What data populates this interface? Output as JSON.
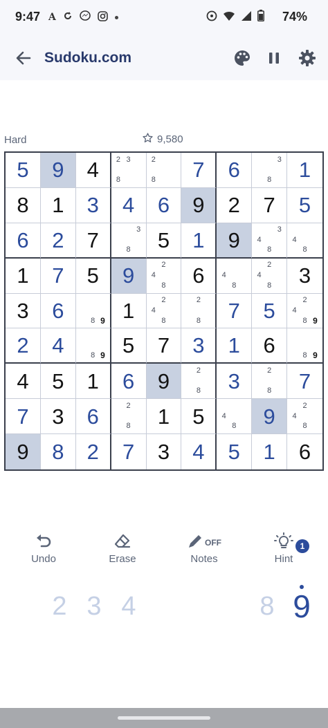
{
  "status_bar": {
    "time": "9:47",
    "battery": "74%"
  },
  "app_bar": {
    "title": "Sudoku.com"
  },
  "game": {
    "difficulty": "Hard",
    "score": "9,580"
  },
  "board": {
    "rows": [
      [
        {
          "v": "5",
          "t": "user"
        },
        {
          "v": "9",
          "t": "user",
          "hl": true
        },
        {
          "v": "4",
          "t": "given"
        },
        {
          "n": [
            "2",
            "3",
            "",
            "",
            "",
            "",
            "8",
            "",
            ""
          ]
        },
        {
          "n": [
            "2",
            "",
            "",
            "",
            "",
            "",
            "8",
            "",
            ""
          ],
          "c": true
        },
        {
          "v": "7",
          "t": "user"
        },
        {
          "v": "6",
          "t": "user"
        },
        {
          "n": [
            "",
            "",
            "3",
            "",
            "",
            "",
            "",
            "8",
            ""
          ]
        },
        {
          "v": "1",
          "t": "user"
        }
      ],
      [
        {
          "v": "8",
          "t": "given"
        },
        {
          "v": "1",
          "t": "given"
        },
        {
          "v": "3",
          "t": "user"
        },
        {
          "v": "4",
          "t": "user"
        },
        {
          "v": "6",
          "t": "user"
        },
        {
          "v": "9",
          "t": "given",
          "hl": true
        },
        {
          "v": "2",
          "t": "given"
        },
        {
          "v": "7",
          "t": "given"
        },
        {
          "v": "5",
          "t": "user"
        }
      ],
      [
        {
          "v": "6",
          "t": "user"
        },
        {
          "v": "2",
          "t": "user"
        },
        {
          "v": "7",
          "t": "given"
        },
        {
          "n": [
            "",
            "",
            "3",
            "",
            "",
            "",
            "",
            "8",
            ""
          ]
        },
        {
          "v": "5",
          "t": "given"
        },
        {
          "v": "1",
          "t": "user"
        },
        {
          "v": "9",
          "t": "given",
          "hl": true
        },
        {
          "n": [
            "",
            "",
            "3",
            "4",
            "",
            "",
            "",
            "8",
            ""
          ]
        },
        {
          "n": [
            "",
            "",
            "",
            "4",
            "",
            "",
            "",
            "8",
            ""
          ]
        }
      ],
      [
        {
          "v": "1",
          "t": "given"
        },
        {
          "v": "7",
          "t": "user"
        },
        {
          "v": "5",
          "t": "given"
        },
        {
          "v": "9",
          "t": "user",
          "hl": true
        },
        {
          "n": [
            "",
            "2",
            "",
            "4",
            "",
            "",
            "",
            "8",
            ""
          ]
        },
        {
          "v": "6",
          "t": "given"
        },
        {
          "n": [
            "",
            "",
            "",
            "4",
            "",
            "",
            "",
            "8",
            ""
          ]
        },
        {
          "n": [
            "",
            "2",
            "",
            "4",
            "",
            "",
            "",
            "8",
            ""
          ]
        },
        {
          "v": "3",
          "t": "given"
        }
      ],
      [
        {
          "v": "3",
          "t": "given"
        },
        {
          "v": "6",
          "t": "user"
        },
        {
          "n": [
            "",
            "",
            "",
            "",
            "",
            "",
            "",
            "8",
            "9"
          ],
          "b": [
            8
          ]
        },
        {
          "v": "1",
          "t": "given"
        },
        {
          "n": [
            "",
            "2",
            "",
            "4",
            "",
            "",
            "",
            "8",
            ""
          ]
        },
        {
          "n": [
            "",
            "2",
            "",
            "",
            "",
            "",
            "",
            "8",
            ""
          ]
        },
        {
          "v": "7",
          "t": "user"
        },
        {
          "v": "5",
          "t": "user"
        },
        {
          "n": [
            "",
            "2",
            "",
            "4",
            "",
            "",
            "",
            "8",
            "9"
          ],
          "b": [
            8
          ]
        }
      ],
      [
        {
          "v": "2",
          "t": "user"
        },
        {
          "v": "4",
          "t": "user"
        },
        {
          "n": [
            "",
            "",
            "",
            "",
            "",
            "",
            "",
            "8",
            "9"
          ],
          "b": [
            8
          ]
        },
        {
          "v": "5",
          "t": "given"
        },
        {
          "v": "7",
          "t": "given"
        },
        {
          "v": "3",
          "t": "user"
        },
        {
          "v": "1",
          "t": "user"
        },
        {
          "v": "6",
          "t": "given"
        },
        {
          "n": [
            "",
            "",
            "",
            "",
            "",
            "",
            "",
            "8",
            "9"
          ],
          "b": [
            8
          ]
        }
      ],
      [
        {
          "v": "4",
          "t": "given"
        },
        {
          "v": "5",
          "t": "given"
        },
        {
          "v": "1",
          "t": "given"
        },
        {
          "v": "6",
          "t": "user"
        },
        {
          "v": "9",
          "t": "given",
          "hl": true
        },
        {
          "n": [
            "",
            "2",
            "",
            "",
            "",
            "",
            "",
            "8",
            ""
          ]
        },
        {
          "v": "3",
          "t": "user"
        },
        {
          "n": [
            "",
            "2",
            "",
            "",
            "",
            "",
            "",
            "8",
            ""
          ]
        },
        {
          "v": "7",
          "t": "user"
        }
      ],
      [
        {
          "v": "7",
          "t": "user"
        },
        {
          "v": "3",
          "t": "given"
        },
        {
          "v": "6",
          "t": "user"
        },
        {
          "n": [
            "",
            "2",
            "",
            "",
            "",
            "",
            "",
            "8",
            ""
          ]
        },
        {
          "v": "1",
          "t": "given"
        },
        {
          "v": "5",
          "t": "given"
        },
        {
          "n": [
            "",
            "",
            "",
            "4",
            "",
            "",
            "",
            "8",
            ""
          ]
        },
        {
          "v": "9",
          "t": "user",
          "hl": true
        },
        {
          "n": [
            "",
            "2",
            "",
            "4",
            "",
            "",
            "",
            "8",
            ""
          ]
        }
      ],
      [
        {
          "v": "9",
          "t": "given",
          "hl": true
        },
        {
          "v": "8",
          "t": "user"
        },
        {
          "v": "2",
          "t": "user"
        },
        {
          "v": "7",
          "t": "user"
        },
        {
          "v": "3",
          "t": "given"
        },
        {
          "v": "4",
          "t": "user"
        },
        {
          "v": "5",
          "t": "user"
        },
        {
          "v": "1",
          "t": "user"
        },
        {
          "v": "6",
          "t": "given"
        }
      ]
    ]
  },
  "tools": {
    "undo": "Undo",
    "erase": "Erase",
    "notes": "Notes",
    "notes_state": "OFF",
    "hint": "Hint",
    "hint_count": "1"
  },
  "numpad": {
    "digits": [
      "2",
      "3",
      "4",
      "8",
      "9"
    ],
    "active": "9"
  },
  "colors": {
    "accent": "#2c4c9c",
    "highlight": "#c8d1e1",
    "inactive_digit": "#c5d0e5"
  },
  "icons": [
    "back-arrow-icon",
    "palette-icon",
    "pause-icon",
    "gear-icon",
    "star-icon",
    "undo-icon",
    "eraser-icon",
    "pencil-icon",
    "lightbulb-icon"
  ]
}
